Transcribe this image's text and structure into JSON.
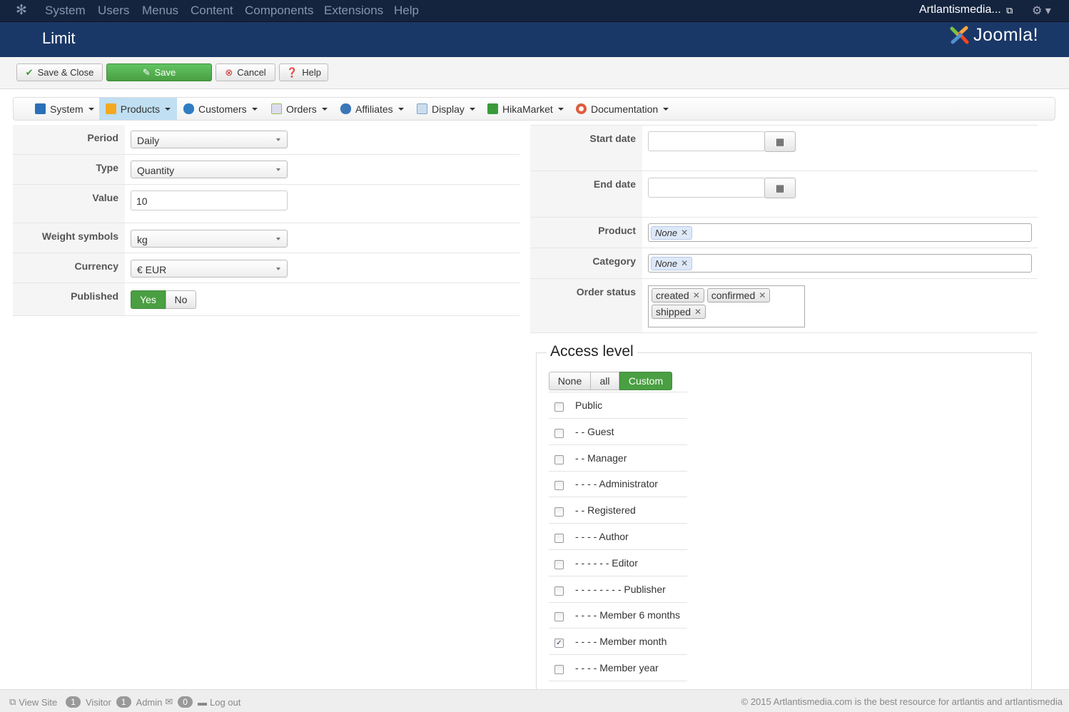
{
  "topnav": {
    "items": [
      "System",
      "Users",
      "Menus",
      "Content",
      "Components",
      "Extensions",
      "Help"
    ],
    "site": "Artlantismedia...",
    "icons": [
      "joomla-icon",
      "external-link-icon",
      "gear-icon"
    ]
  },
  "header": {
    "title": "Limit",
    "logo": "Joomla!"
  },
  "toolbar": {
    "save_close": "Save & Close",
    "save": "Save",
    "cancel": "Cancel",
    "help": "Help"
  },
  "submenu": {
    "items": [
      {
        "label": "System",
        "icon": "tools-icon",
        "color": "#2a6fb8"
      },
      {
        "label": "Products",
        "icon": "box-icon",
        "color": "#f6a821"
      },
      {
        "label": "Customers",
        "icon": "users-icon",
        "color": "#2f7ec2"
      },
      {
        "label": "Orders",
        "icon": "document-icon",
        "color": "#9bbf52"
      },
      {
        "label": "Affiliates",
        "icon": "affiliate-icon",
        "color": "#3b77b7"
      },
      {
        "label": "Display",
        "icon": "display-icon",
        "color": "#7aa6c8"
      },
      {
        "label": "HikaMarket",
        "icon": "hikamarket-icon",
        "color": "#3a9a3a"
      },
      {
        "label": "Documentation",
        "icon": "lifebuoy-icon",
        "color": "#e05a3a"
      }
    ],
    "active": "Products"
  },
  "left_form": {
    "period": {
      "label": "Period",
      "value": "Daily"
    },
    "type": {
      "label": "Type",
      "value": "Quantity"
    },
    "value": {
      "label": "Value",
      "value": "10"
    },
    "weight": {
      "label": "Weight symbols",
      "value": "kg"
    },
    "currency": {
      "label": "Currency",
      "value": "€ EUR"
    },
    "published": {
      "label": "Published",
      "yes": "Yes",
      "no": "No",
      "selected": "Yes"
    }
  },
  "right_form": {
    "start_date": {
      "label": "Start date",
      "value": ""
    },
    "end_date": {
      "label": "End date",
      "value": ""
    },
    "product": {
      "label": "Product",
      "tags": [
        "None"
      ]
    },
    "category": {
      "label": "Category",
      "tags": [
        "None"
      ]
    },
    "order_status": {
      "label": "Order status",
      "tags": [
        "created",
        "confirmed",
        "shipped"
      ]
    }
  },
  "access": {
    "legend": "Access level",
    "modes": [
      "None",
      "all",
      "Custom"
    ],
    "selected_mode": "Custom",
    "groups": [
      {
        "label": "Public",
        "checked": false
      },
      {
        "label": "- - Guest",
        "checked": false
      },
      {
        "label": "- - Manager",
        "checked": false
      },
      {
        "label": "- - - - Administrator",
        "checked": false
      },
      {
        "label": "- - Registered",
        "checked": false
      },
      {
        "label": "- - - - Author",
        "checked": false
      },
      {
        "label": "- - - - - - Editor",
        "checked": false
      },
      {
        "label": "- - - - - - - - Publisher",
        "checked": false
      },
      {
        "label": "- - - - Member 6 months",
        "checked": false
      },
      {
        "label": "- - - - Member month",
        "checked": true
      },
      {
        "label": "- - - - Member year",
        "checked": false
      }
    ]
  },
  "footer": {
    "view_site": "View Site",
    "visitors": "1",
    "visitor_label": "Visitor",
    "admins": "1",
    "admin_label": "Admin",
    "messages": "0",
    "logout": "Log out",
    "copyright": "© 2015 Artlantismedia.com is the best resource for artlantis and artlantismedia"
  },
  "colors": {
    "topnav": "#14243f",
    "header": "#1a3867",
    "green": "#4a9f42",
    "active_tab": "#c0dff2"
  }
}
